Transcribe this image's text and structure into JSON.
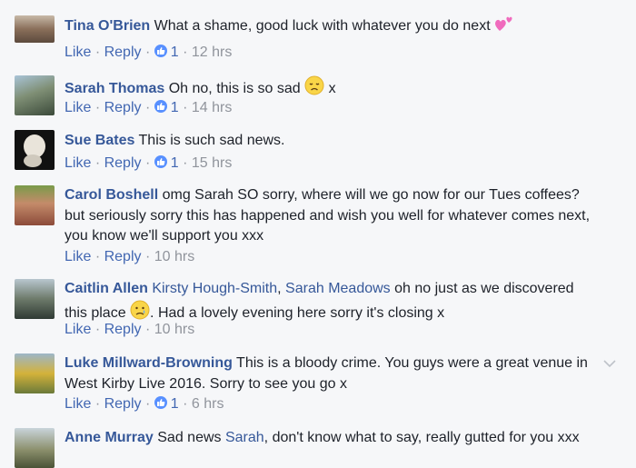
{
  "actions": {
    "like": "Like",
    "reply": "Reply",
    "dot": "·"
  },
  "comments": [
    {
      "author": "Tina O'Brien",
      "text": "What a shame, good luck with whatever you do next",
      "emoji": "two-hearts",
      "likes": "1",
      "time": "12 hrs"
    },
    {
      "author": "Sarah Thomas",
      "text": "Oh no, this is so sad",
      "emoji": "disappointed-face",
      "text_after": "x",
      "likes": "1",
      "time": "14 hrs"
    },
    {
      "author": "Sue Bates",
      "text": "This is such sad news.",
      "likes": "1",
      "time": "15 hrs"
    },
    {
      "author": "Carol Boshell",
      "text": "omg Sarah SO sorry, where will we go now for our Tues coffees? but seriously sorry this has happened and wish you well for whatever comes next, you know we'll support you xxx",
      "time": "10 hrs"
    },
    {
      "author": "Caitlin Allen",
      "mention1": "Kirsty Hough-Smith",
      "comma": ",",
      "mention2": "Sarah Meadows",
      "text": "oh no just as we discovered this place",
      "emoji": "crying-face",
      "text_after": ". Had a lovely evening here sorry it's closing x",
      "time": "10 hrs"
    },
    {
      "author": "Luke Millward-Browning",
      "text": "This is a bloody crime. You guys were a great venue in West Kirby Live 2016. Sorry to see you go x",
      "likes": "1",
      "time": "6 hrs"
    },
    {
      "author": "Anne Murray",
      "text": "Sad news",
      "mention1": "Sarah",
      "text_after": ", don't know what to say, really gutted for you xxx"
    }
  ],
  "colors": {
    "link": "#365899",
    "meta": "#90949c",
    "like_blue": "#5890ff"
  }
}
